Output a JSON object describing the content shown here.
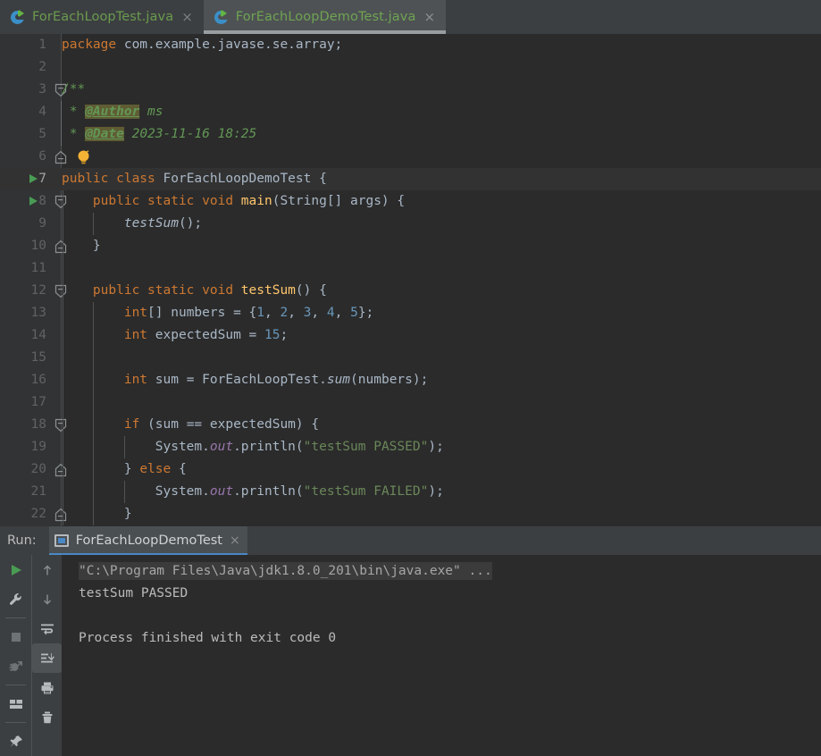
{
  "editor_tabs": [
    {
      "label": "ForEachLoopTest.java",
      "icon": "java-class-icon",
      "close": "×",
      "active": false
    },
    {
      "label": "ForEachLoopDemoTest.java",
      "icon": "java-class-icon",
      "close": "×",
      "active": true
    }
  ],
  "editor": {
    "language": "java",
    "current_line": 7,
    "lines": [
      {
        "n": "1",
        "indent_guides": 0,
        "fold": "",
        "run": false,
        "bulb": false,
        "tokens": [
          {
            "t": "package ",
            "c": "kw"
          },
          {
            "t": "com.example.javase.se.array;",
            "c": "id"
          }
        ]
      },
      {
        "n": "2",
        "indent_guides": 0,
        "fold": "",
        "run": false,
        "bulb": false,
        "tokens": []
      },
      {
        "n": "3",
        "indent_guides": 0,
        "fold": "start",
        "run": false,
        "bulb": false,
        "tokens": [
          {
            "t": "/**",
            "c": "cmt"
          }
        ]
      },
      {
        "n": "4",
        "indent_guides": 0,
        "fold": "line",
        "run": false,
        "bulb": false,
        "tokens": [
          {
            "t": " * ",
            "c": "cmt"
          },
          {
            "t": "@Author",
            "c": "tag"
          },
          {
            "t": " ms",
            "c": "cmt"
          }
        ]
      },
      {
        "n": "5",
        "indent_guides": 0,
        "fold": "line",
        "run": false,
        "bulb": false,
        "tokens": [
          {
            "t": " * ",
            "c": "cmt"
          },
          {
            "t": "@Date",
            "c": "tag"
          },
          {
            "t": " 2023-11-16 18:25",
            "c": "cmt"
          }
        ]
      },
      {
        "n": "6",
        "indent_guides": 0,
        "fold": "end",
        "run": false,
        "bulb": true,
        "tokens": []
      },
      {
        "n": "7",
        "indent_guides": 0,
        "fold": "",
        "run": true,
        "bulb": false,
        "tokens": [
          {
            "t": "public class ",
            "c": "kw"
          },
          {
            "t": "ForEachLoopDemoTest",
            "c": "id"
          },
          {
            "t": " {",
            "c": "id"
          }
        ]
      },
      {
        "n": "8",
        "indent_guides": 1,
        "fold": "start",
        "run": true,
        "bulb": false,
        "tokens": [
          {
            "t": "    ",
            "c": "id"
          },
          {
            "t": "public static void ",
            "c": "kw"
          },
          {
            "t": "main",
            "c": "fn"
          },
          {
            "t": "(String[] args) {",
            "c": "id"
          }
        ]
      },
      {
        "n": "9",
        "indent_guides": 2,
        "fold": "",
        "run": false,
        "bulb": false,
        "tokens": [
          {
            "t": "        ",
            "c": "id"
          },
          {
            "t": "testSum",
            "c": "st"
          },
          {
            "t": "();",
            "c": "id"
          }
        ]
      },
      {
        "n": "10",
        "indent_guides": 1,
        "fold": "end",
        "run": false,
        "bulb": false,
        "tokens": [
          {
            "t": "    }",
            "c": "id"
          }
        ]
      },
      {
        "n": "11",
        "indent_guides": 1,
        "fold": "",
        "run": false,
        "bulb": false,
        "tokens": []
      },
      {
        "n": "12",
        "indent_guides": 1,
        "fold": "start",
        "run": false,
        "bulb": false,
        "tokens": [
          {
            "t": "    ",
            "c": "id"
          },
          {
            "t": "public static void ",
            "c": "kw"
          },
          {
            "t": "testSum",
            "c": "fn"
          },
          {
            "t": "() {",
            "c": "id"
          }
        ]
      },
      {
        "n": "13",
        "indent_guides": 2,
        "fold": "",
        "run": false,
        "bulb": false,
        "tokens": [
          {
            "t": "        ",
            "c": "id"
          },
          {
            "t": "int",
            "c": "kw"
          },
          {
            "t": "[] numbers = {",
            "c": "id"
          },
          {
            "t": "1",
            "c": "num"
          },
          {
            "t": ", ",
            "c": "id"
          },
          {
            "t": "2",
            "c": "num"
          },
          {
            "t": ", ",
            "c": "id"
          },
          {
            "t": "3",
            "c": "num"
          },
          {
            "t": ", ",
            "c": "id"
          },
          {
            "t": "4",
            "c": "num"
          },
          {
            "t": ", ",
            "c": "id"
          },
          {
            "t": "5",
            "c": "num"
          },
          {
            "t": "};",
            "c": "id"
          }
        ]
      },
      {
        "n": "14",
        "indent_guides": 2,
        "fold": "",
        "run": false,
        "bulb": false,
        "tokens": [
          {
            "t": "        ",
            "c": "id"
          },
          {
            "t": "int",
            "c": "kw"
          },
          {
            "t": " expectedSum = ",
            "c": "id"
          },
          {
            "t": "15",
            "c": "num"
          },
          {
            "t": ";",
            "c": "id"
          }
        ]
      },
      {
        "n": "15",
        "indent_guides": 2,
        "fold": "",
        "run": false,
        "bulb": false,
        "tokens": []
      },
      {
        "n": "16",
        "indent_guides": 2,
        "fold": "",
        "run": false,
        "bulb": false,
        "tokens": [
          {
            "t": "        ",
            "c": "id"
          },
          {
            "t": "int",
            "c": "kw"
          },
          {
            "t": " sum = ForEachLoopTest.",
            "c": "id"
          },
          {
            "t": "sum",
            "c": "st"
          },
          {
            "t": "(numbers);",
            "c": "id"
          }
        ]
      },
      {
        "n": "17",
        "indent_guides": 2,
        "fold": "",
        "run": false,
        "bulb": false,
        "tokens": []
      },
      {
        "n": "18",
        "indent_guides": 2,
        "fold": "start",
        "run": false,
        "bulb": false,
        "tokens": [
          {
            "t": "        ",
            "c": "id"
          },
          {
            "t": "if",
            "c": "kw"
          },
          {
            "t": " (sum == expectedSum) {",
            "c": "id"
          }
        ]
      },
      {
        "n": "19",
        "indent_guides": 3,
        "fold": "",
        "run": false,
        "bulb": false,
        "tokens": [
          {
            "t": "            System.",
            "c": "id"
          },
          {
            "t": "out",
            "c": "fldstatic"
          },
          {
            "t": ".println(",
            "c": "id"
          },
          {
            "t": "\"testSum PASSED\"",
            "c": "str"
          },
          {
            "t": ");",
            "c": "id"
          }
        ]
      },
      {
        "n": "20",
        "indent_guides": 2,
        "fold": "end",
        "run": false,
        "bulb": false,
        "tokens": [
          {
            "t": "        } ",
            "c": "id"
          },
          {
            "t": "else",
            "c": "kw"
          },
          {
            "t": " {",
            "c": "id"
          }
        ]
      },
      {
        "n": "21",
        "indent_guides": 3,
        "fold": "",
        "run": false,
        "bulb": false,
        "tokens": [
          {
            "t": "            System.",
            "c": "id"
          },
          {
            "t": "out",
            "c": "fldstatic"
          },
          {
            "t": ".println(",
            "c": "id"
          },
          {
            "t": "\"testSum FAILED\"",
            "c": "str"
          },
          {
            "t": ");",
            "c": "id"
          }
        ]
      },
      {
        "n": "22",
        "indent_guides": 2,
        "fold": "end",
        "run": false,
        "bulb": false,
        "tokens": [
          {
            "t": "        }",
            "c": "id"
          }
        ]
      }
    ]
  },
  "run_window": {
    "title": "Run:",
    "tab": {
      "label": "ForEachLoopDemoTest",
      "icon": "console-window-icon",
      "close": "×"
    },
    "toolbar_left": [
      {
        "name": "rerun-button",
        "icon": "play-icon"
      },
      {
        "name": "edit-configuration-button",
        "icon": "wrench-icon"
      },
      {
        "name": "stop-button",
        "icon": "stop-square-icon"
      },
      {
        "name": "stop-background-processes-button",
        "icon": "bug-exit-icon"
      },
      {
        "name": "layout-button",
        "icon": "layout-icon"
      },
      {
        "name": "pin-tab-button",
        "icon": "pin-icon"
      }
    ],
    "toolbar_right": [
      {
        "name": "up-the-stack-button",
        "icon": "arrow-up-icon"
      },
      {
        "name": "down-the-stack-button",
        "icon": "arrow-down-icon"
      },
      {
        "name": "soft-wrap-button",
        "icon": "soft-wrap-icon"
      },
      {
        "name": "scroll-to-end-button",
        "icon": "scroll-to-end-icon",
        "selected": true
      },
      {
        "name": "print-button",
        "icon": "printer-icon"
      },
      {
        "name": "clear-all-button",
        "icon": "trash-icon"
      }
    ],
    "console_lines": [
      {
        "text": "\"C:\\Program Files\\Java\\jdk1.8.0_201\\bin\\java.exe\" ...",
        "style": "cmd"
      },
      {
        "text": "testSum PASSED",
        "style": "out"
      },
      {
        "text": "",
        "style": "out"
      },
      {
        "text": "Process finished with exit code 0",
        "style": "out"
      }
    ]
  },
  "colors": {
    "editor_bg": "#2b2b2b",
    "gutter_bg": "#313335",
    "panel_bg": "#3c3f41",
    "tab_active_bg": "#4e5254",
    "keyword": "#cc7832",
    "number": "#6897bb",
    "string": "#6a8759",
    "comment": "#629755",
    "identifier": "#a9b7c6",
    "method": "#ffc66d",
    "static_field": "#9876aa",
    "tab_text_green": "#6a9a4f",
    "run_tab_underline": "#4a88c7",
    "run_marker_green": "#499c54",
    "console_text": "#bbbbbb"
  }
}
